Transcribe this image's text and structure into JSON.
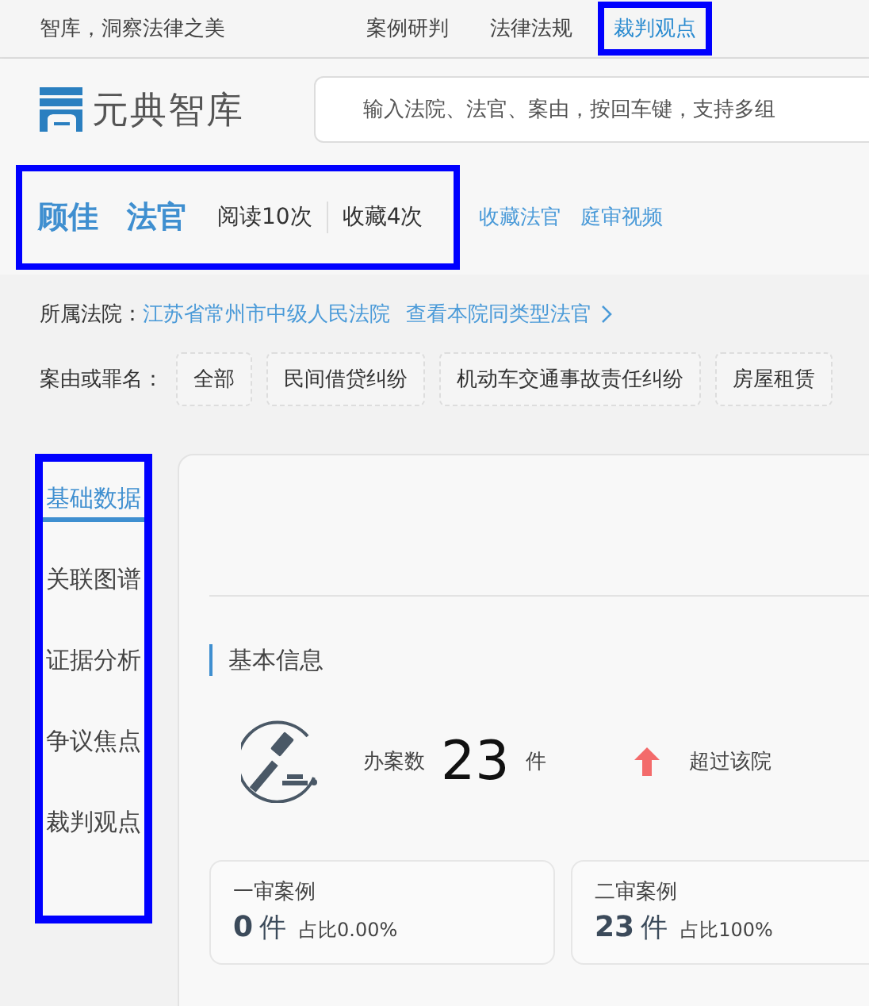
{
  "topbar": {
    "slogan": "智库，洞察法律之美",
    "nav": [
      {
        "label": "案例研判",
        "selected": false
      },
      {
        "label": "法律法规",
        "selected": false
      },
      {
        "label": "裁判观点",
        "selected": true
      }
    ]
  },
  "header": {
    "logo": "元典智库",
    "search": {
      "placeholder": "输入法院、法官、案由，按回车键，支持多组"
    }
  },
  "judge": {
    "name": "顾佳",
    "title": "法官",
    "reads": "阅读10次",
    "favorites": "收藏4次",
    "links": [
      "收藏法官",
      "庭审视频"
    ]
  },
  "court": {
    "label": "所属法院：",
    "name": "江苏省常州市中级人民法院",
    "link": "查看本院同类型法官"
  },
  "filters": {
    "label": "案由或罪名：",
    "tags": [
      {
        "label": "全部",
        "selected": false
      },
      {
        "label": "民间借贷纠纷",
        "selected": false
      },
      {
        "label": "机动车交通事故责任纠纷",
        "selected": false
      },
      {
        "label": "房屋租赁",
        "selected": false
      }
    ]
  },
  "sidebar": {
    "items": [
      {
        "label": "基础数据",
        "selected": true
      },
      {
        "label": "关联图谱",
        "selected": false
      },
      {
        "label": "证据分析",
        "selected": false
      },
      {
        "label": "争议焦点",
        "selected": false
      },
      {
        "label": "裁判观点",
        "selected": false
      }
    ]
  },
  "basic_info": {
    "title": "基本信息",
    "cases_label": "办案数",
    "cases_count": "23",
    "cases_unit": "件",
    "compare": "超过该院"
  },
  "stat_cards": [
    {
      "title": "一审案例",
      "count": "0",
      "unit": "件",
      "share": "占比0.00%"
    },
    {
      "title": "二审案例",
      "count": "23",
      "unit": "件",
      "share": "占比100%"
    }
  ]
}
